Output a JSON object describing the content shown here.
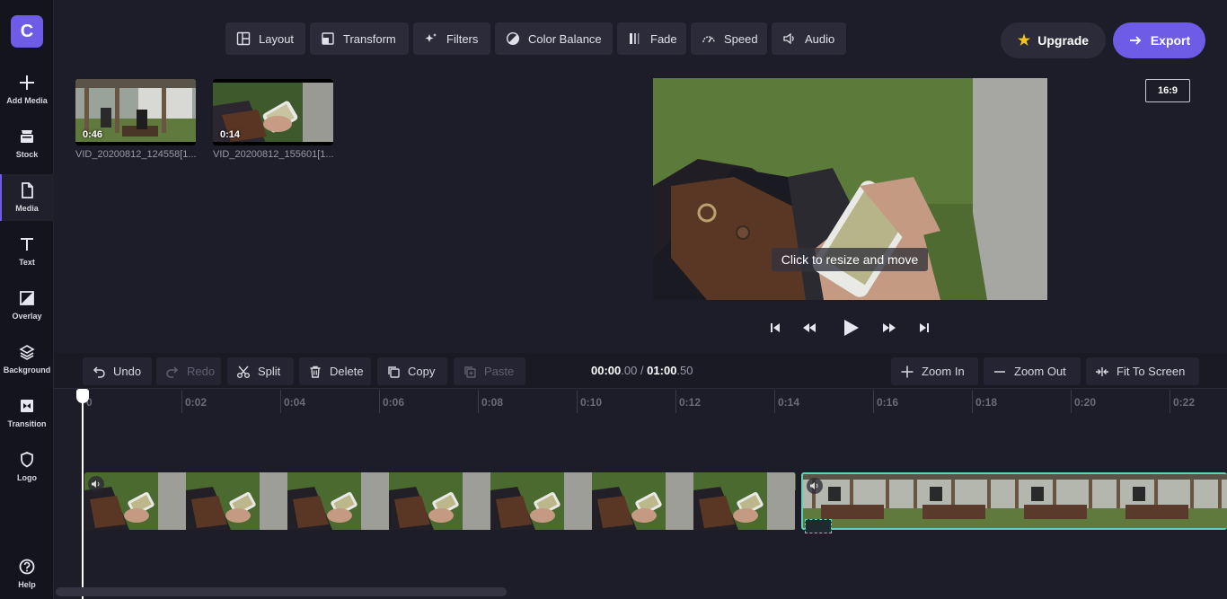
{
  "app": {
    "logo_letter": "C",
    "brand_color": "#6e5ce6"
  },
  "sidebar": {
    "items": [
      {
        "label": "Add Media",
        "icon": "plus-icon"
      },
      {
        "label": "Stock",
        "icon": "stock-icon"
      },
      {
        "label": "Media",
        "icon": "file-icon",
        "active": true
      },
      {
        "label": "Text",
        "icon": "text-icon"
      },
      {
        "label": "Overlay",
        "icon": "overlay-icon"
      },
      {
        "label": "Background",
        "icon": "layers-icon"
      },
      {
        "label": "Transition",
        "icon": "transition-icon"
      },
      {
        "label": "Logo",
        "icon": "shield-icon"
      },
      {
        "label": "Help",
        "icon": "help-icon"
      }
    ]
  },
  "toolbar": {
    "layout": "Layout",
    "transform": "Transform",
    "filters": "Filters",
    "color_balance": "Color Balance",
    "fade": "Fade",
    "speed": "Speed",
    "audio": "Audio",
    "upgrade": "Upgrade",
    "export": "Export"
  },
  "media": [
    {
      "duration": "0:46",
      "name": "VID_20200812_124558[1..."
    },
    {
      "duration": "0:14",
      "name": "VID_20200812_155601[1..."
    }
  ],
  "preview": {
    "hint": "Click to resize and move",
    "aspect_ratio": "16:9"
  },
  "timeline_toolbar": {
    "undo": "Undo",
    "redo": "Redo",
    "split": "Split",
    "delete": "Delete",
    "copy": "Copy",
    "paste": "Paste",
    "time_current_main": "00:00",
    "time_current_frac": ".00",
    "time_separator": " / ",
    "time_total_main": "01:00",
    "time_total_frac": ".50",
    "zoom_in": "Zoom In",
    "zoom_out": "Zoom Out",
    "fit_to_screen": "Fit To Screen"
  },
  "ruler": {
    "labels": [
      "0",
      "0:02",
      "0:04",
      "0:06",
      "0:08",
      "0:10",
      "0:12",
      "0:14",
      "0:16",
      "0:18",
      "0:20",
      "0:22"
    ]
  },
  "timeline": {
    "selected_clip_color": "#5fd3b4"
  }
}
